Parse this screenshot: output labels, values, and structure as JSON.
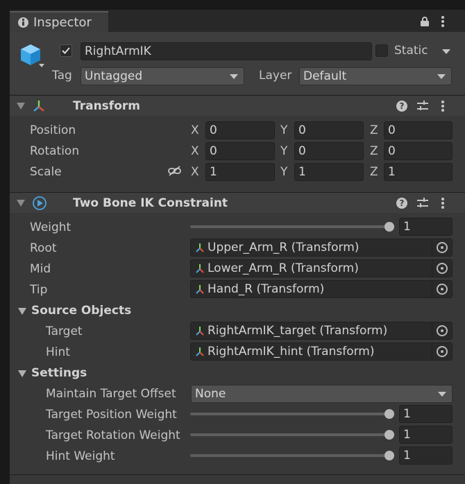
{
  "tab": {
    "title": "Inspector"
  },
  "header": {
    "object_name": "RightArmIK",
    "active": true,
    "static_label": "Static",
    "static_checked": false,
    "tag_label": "Tag",
    "tag_value": "Untagged",
    "layer_label": "Layer",
    "layer_value": "Default"
  },
  "transform": {
    "title": "Transform",
    "rows": [
      {
        "label": "Position",
        "x": "0",
        "y": "0",
        "z": "0"
      },
      {
        "label": "Rotation",
        "x": "0",
        "y": "0",
        "z": "0"
      },
      {
        "label": "Scale",
        "x": "1",
        "y": "1",
        "z": "1"
      }
    ],
    "axis_x": "X",
    "axis_y": "Y",
    "axis_z": "Z"
  },
  "constraint": {
    "title": "Two Bone IK Constraint",
    "weight_label": "Weight",
    "weight_value": "1",
    "root_label": "Root",
    "root_value": "Upper_Arm_R (Transform)",
    "mid_label": "Mid",
    "mid_value": "Lower_Arm_R (Transform)",
    "tip_label": "Tip",
    "tip_value": "Hand_R (Transform)",
    "source_objects": {
      "title": "Source Objects",
      "target_label": "Target",
      "target_value": "RightArmIK_target (Transform)",
      "hint_label": "Hint",
      "hint_value": "RightArmIK_hint (Transform)"
    },
    "settings": {
      "title": "Settings",
      "maintain_offset_label": "Maintain Target Offset",
      "maintain_offset_value": "None",
      "target_position_weight_label": "Target Position Weight",
      "target_position_weight_value": "1",
      "target_rotation_weight_label": "Target Rotation Weight",
      "target_rotation_weight_value": "1",
      "hint_weight_label": "Hint Weight",
      "hint_weight_value": "1"
    }
  },
  "colors": {
    "panel": "#383838",
    "field": "#2a2a2a",
    "header": "#3e3e3e",
    "accent_blue": "#4aa3df"
  },
  "slider_levels": {
    "weight": 1,
    "target_position_weight": 1,
    "target_rotation_weight": 1,
    "hint_weight": 1
  }
}
